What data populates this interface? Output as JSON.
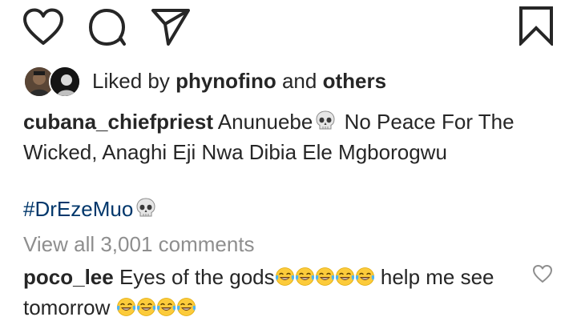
{
  "icons": {
    "like": "heart-outline-icon",
    "comment": "comment-bubble-icon",
    "share": "paper-plane-icon",
    "save": "bookmark-outline-icon",
    "comment_like": "small-heart-outline-icon"
  },
  "likes": {
    "prefix": "Liked by",
    "user": "phynofino",
    "connector": "and",
    "others": "others"
  },
  "caption": {
    "username": "cubana_chiefpriest",
    "text_before_emoji": "Anunuebe",
    "emoji": "skull",
    "text_after_emoji": "No Peace For The Wicked, Anaghi Eji Nwa Dibia Ele Mgborogwu"
  },
  "hashtag": {
    "text": "#DrEzeMuo",
    "emoji": "skull"
  },
  "view_comments": "View all 3,001 comments",
  "top_comment": {
    "username": "poco_lee",
    "text_part1": "Eyes of the gods",
    "emoji_group1": [
      "tears-of-joy",
      "tears-of-joy",
      "tears-of-joy",
      "tears-of-joy",
      "tears-of-joy"
    ],
    "text_part2": "help me see tomorrow",
    "emoji_group2": [
      "tears-of-joy",
      "tears-of-joy",
      "tears-of-joy",
      "tears-of-joy"
    ]
  },
  "colors": {
    "text": "#262626",
    "hashtag": "#00376b",
    "muted": "#8e8e8e"
  }
}
